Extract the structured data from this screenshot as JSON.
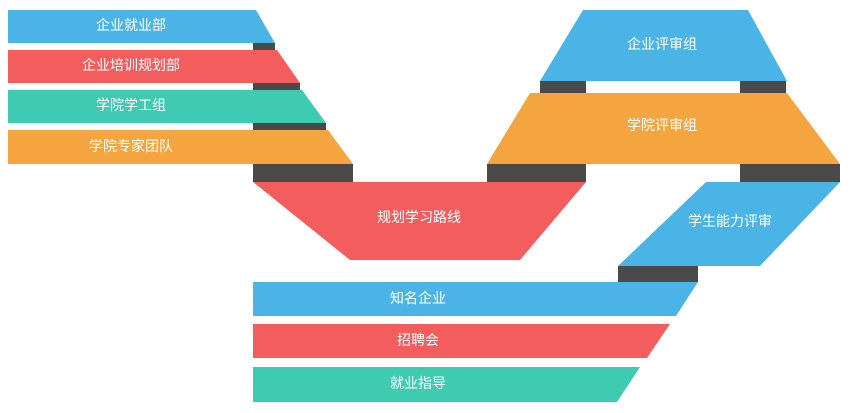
{
  "colors": {
    "blue": "#4bb4e6",
    "red": "#f45d5d",
    "teal": "#3ecbb2",
    "orange": "#f5a540",
    "connector": "#4a4a4a",
    "text": "#ffffff"
  },
  "left_stack": [
    {
      "label": "企业就业部",
      "color": "blue"
    },
    {
      "label": "企业培训规划部",
      "color": "red"
    },
    {
      "label": "学院学工组",
      "color": "teal"
    },
    {
      "label": "学院专家团队",
      "color": "orange"
    }
  ],
  "center_node": {
    "label": "规划学习路线",
    "color": "red"
  },
  "right_stack": [
    {
      "label": "企业评审组",
      "color": "blue"
    },
    {
      "label": "学院评审组",
      "color": "orange"
    }
  ],
  "assessment_node": {
    "label": "学生能力评审",
    "color": "blue"
  },
  "bottom_stack": [
    {
      "label": "知名企业",
      "color": "blue"
    },
    {
      "label": "招聘会",
      "color": "red"
    },
    {
      "label": "就业指导",
      "color": "teal"
    }
  ]
}
